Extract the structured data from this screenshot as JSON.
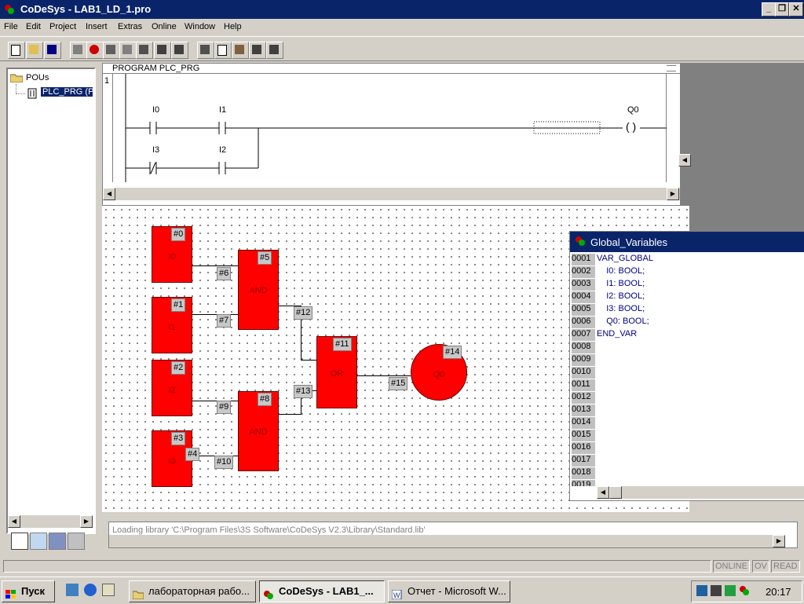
{
  "window": {
    "title": "CoDeSys - LAB1_LD_1.pro"
  },
  "menu": [
    "File",
    "Edit",
    "Project",
    "Insert",
    "Extras",
    "Online",
    "Window",
    "Help"
  ],
  "tree": {
    "root": "POUs",
    "item": "PLC_PRG (P"
  },
  "editor": {
    "header": "PROGRAM PLC_PRG",
    "network_number": "1",
    "contacts": [
      {
        "label": "I0"
      },
      {
        "label": "I1"
      },
      {
        "label": "I3"
      },
      {
        "label": "I2"
      }
    ],
    "coil": {
      "label": "Q0"
    }
  },
  "cfc": {
    "blocks": [
      {
        "name": "I0",
        "num": "#0"
      },
      {
        "name": "I1",
        "num": "#1"
      },
      {
        "name": "I2",
        "num": "#2"
      },
      {
        "name": "I3",
        "num": "#3"
      },
      {
        "name": "AND",
        "num": "#5"
      },
      {
        "name": "AND",
        "num": "#8"
      },
      {
        "name": "OR",
        "num": "#11"
      },
      {
        "name": "Q0",
        "num": "#14"
      }
    ],
    "connectors": [
      "#4",
      "#6",
      "#7",
      "#9",
      "#10",
      "#12",
      "#13",
      "#15"
    ]
  },
  "global_vars": {
    "title": "Global_Variables",
    "lines": [
      {
        "n": "0001",
        "t": "VAR_GLOBAL"
      },
      {
        "n": "0002",
        "t": "    I0: BOOL;"
      },
      {
        "n": "0003",
        "t": "    I1: BOOL;"
      },
      {
        "n": "0004",
        "t": "    I2: BOOL;"
      },
      {
        "n": "0005",
        "t": "    I3: BOOL;"
      },
      {
        "n": "0006",
        "t": "    Q0: BOOL;"
      },
      {
        "n": "0007",
        "t": "END_VAR"
      },
      {
        "n": "0008",
        "t": ""
      },
      {
        "n": "0009",
        "t": ""
      },
      {
        "n": "0010",
        "t": ""
      },
      {
        "n": "0011",
        "t": ""
      },
      {
        "n": "0012",
        "t": ""
      },
      {
        "n": "0013",
        "t": ""
      },
      {
        "n": "0014",
        "t": ""
      },
      {
        "n": "0015",
        "t": ""
      },
      {
        "n": "0016",
        "t": ""
      },
      {
        "n": "0017",
        "t": ""
      },
      {
        "n": "0018",
        "t": ""
      },
      {
        "n": "0019",
        "t": ""
      }
    ]
  },
  "message": "Loading library 'C:\\Program Files\\3S Software\\CoDeSys V2.3\\Library\\Standard.lib'",
  "status": [
    "ONLINE",
    "OV",
    "READ"
  ],
  "taskbar": {
    "start": "Пуск",
    "tasks": [
      "лабораторная рабо...",
      "CoDeSys - LAB1_...",
      "Отчет - Microsoft W..."
    ],
    "clock": "20:17"
  },
  "colors": {
    "titlebar": "#0a246a",
    "block": "#ff0000",
    "code": "#000080"
  }
}
